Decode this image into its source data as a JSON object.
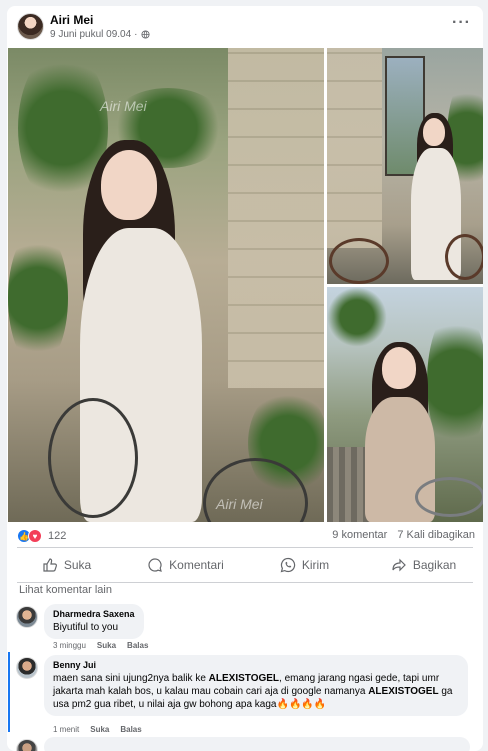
{
  "post": {
    "author": "Airi Mei",
    "timestamp": "9 Juni pukul 09.04",
    "privacy_icon": "public-globe-icon",
    "more_icon": "more-options-icon",
    "watermark": "Airi Mei"
  },
  "stats": {
    "reaction_count": "122",
    "comments": "9 komentar",
    "shares": "7 Kali dibagikan"
  },
  "actions": {
    "like": "Suka",
    "comment": "Komentari",
    "send": "Kirim",
    "share": "Bagikan"
  },
  "comments_section": {
    "see_more": "Lihat komentar lain",
    "items": [
      {
        "name": "Dharmedra Saxena",
        "text": "Biyutiful to you",
        "time": "3 minggu",
        "like": "Suka",
        "reply": "Balas"
      },
      {
        "name": "Benny Jui",
        "text_parts": [
          "maen sana sini ujung2nya balik ke ",
          "ALEXISTOGEL",
          ", emang jarang ngasi gede, tapi umr jakarta mah kalah bos, u kalau mau cobain cari aja di google namanya ",
          "ALEXISTOGEL",
          " ga usa pm2 gua ribet, u nilai aja gw bohong apa kaga🔥🔥🔥🔥"
        ],
        "time": "1 menit",
        "like": "Suka",
        "reply": "Balas"
      }
    ]
  },
  "colors": {
    "accent": "#1877f2",
    "love": "#f33e58",
    "muted": "#65676b",
    "bubble": "#f0f2f5"
  }
}
